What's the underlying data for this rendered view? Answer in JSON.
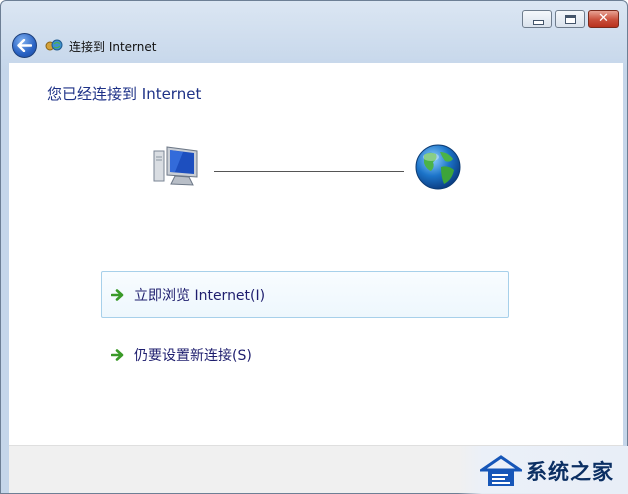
{
  "window": {
    "title": "连接到 Internet",
    "controls": {
      "minimize_icon": "minimize-icon",
      "maximize_icon": "maximize-icon",
      "close_glyph": "✕"
    }
  },
  "nav": {
    "back_icon": "back-arrow-icon"
  },
  "content": {
    "heading": "您已经连接到 Internet",
    "diagram": {
      "left_icon": "computer-icon",
      "right_icon": "globe-icon"
    },
    "options": [
      {
        "label": "立即浏览 Internet(I)",
        "icon": "green-arrow-icon"
      },
      {
        "label": "仍要设置新连接(S)",
        "icon": "green-arrow-icon"
      }
    ]
  },
  "watermark": {
    "text": "系统之家",
    "logo": "house-logo"
  }
}
